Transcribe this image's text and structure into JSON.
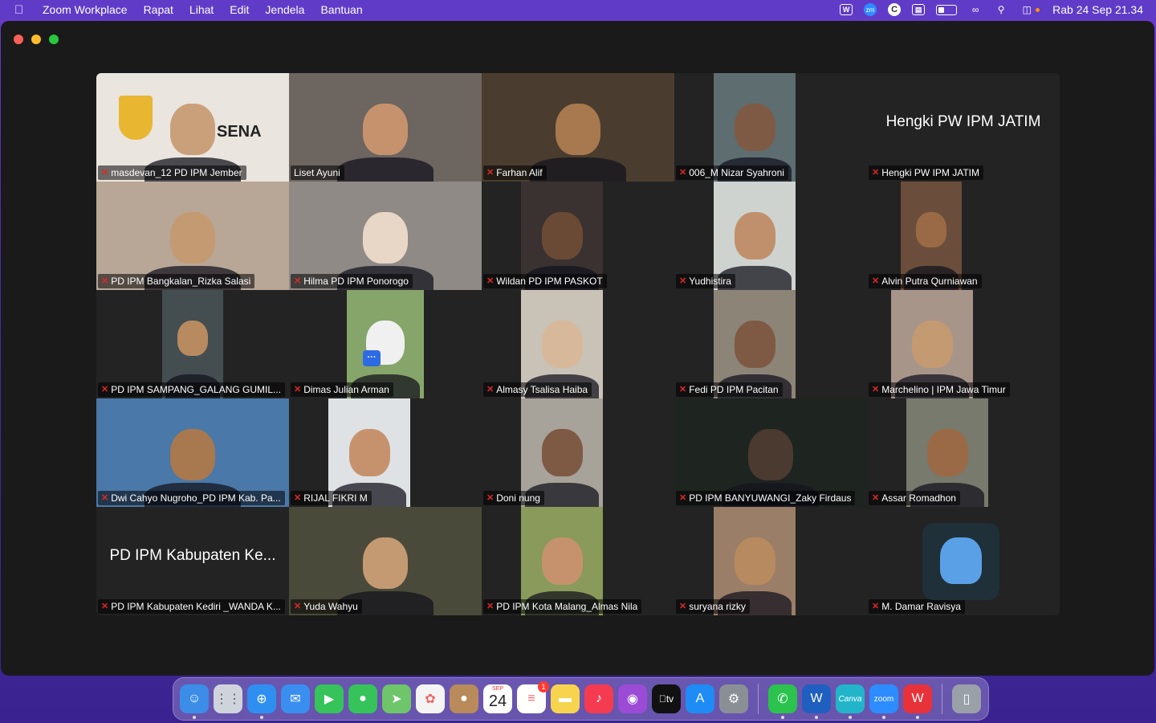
{
  "menubar": {
    "app_name": "Zoom Workplace",
    "menus": [
      "Rapat",
      "Lihat",
      "Edit",
      "Jendela",
      "Bantuan"
    ],
    "clock": "Rab 24 Sep  21.34",
    "status_icons": [
      "word-icon",
      "zoom-icon",
      "c-icon",
      "screen-mirror-icon",
      "battery-icon",
      "link-icon",
      "search-icon",
      "control-center-icon"
    ]
  },
  "meeting": {
    "participants": [
      {
        "name": "masdevan_12 PD IPM Jember",
        "muted": true,
        "video": true,
        "active": false
      },
      {
        "name": "Liset Ayuni",
        "muted": false,
        "video": true,
        "active": true
      },
      {
        "name": "Farhan Alif",
        "muted": true,
        "video": true,
        "active": false
      },
      {
        "name": "006_M Nizar Syahroni",
        "muted": true,
        "video": true,
        "active": false
      },
      {
        "name": "Hengki PW IPM JATIM",
        "display": "Hengki PW IPM JATIM",
        "muted": true,
        "video": false,
        "active": false
      },
      {
        "name": "PD IPM Bangkalan_Rizka Salasi",
        "muted": true,
        "video": true,
        "active": false
      },
      {
        "name": "Hilma PD IPM Ponorogo",
        "muted": true,
        "video": true,
        "active": false
      },
      {
        "name": "Wildan PD IPM PASKOT",
        "muted": true,
        "video": true,
        "active": false
      },
      {
        "name": "Yudhistira",
        "muted": true,
        "video": true,
        "active": false
      },
      {
        "name": "Alvin Putra Qurniawan",
        "muted": true,
        "video": true,
        "active": false
      },
      {
        "name": "PD IPM SAMPANG_GALANG GUMIL...",
        "muted": true,
        "video": true,
        "active": false
      },
      {
        "name": "Dimas Julian Arman",
        "muted": true,
        "video": true,
        "active": false
      },
      {
        "name": "Almasy Tsalisa Haiba",
        "muted": true,
        "video": true,
        "active": false
      },
      {
        "name": "Fedi PD IPM Pacitan",
        "muted": true,
        "video": true,
        "active": false
      },
      {
        "name": "Marchelino | IPM Jawa Timur",
        "muted": true,
        "video": true,
        "active": false
      },
      {
        "name": "Dwi Cahyo Nugroho_PD IPM Kab. Pa...",
        "muted": true,
        "video": true,
        "active": false
      },
      {
        "name": "RIJAL FIKRI M",
        "muted": true,
        "video": true,
        "active": false
      },
      {
        "name": "Doni nung",
        "muted": true,
        "video": true,
        "active": false
      },
      {
        "name": "PD IPM BANYUWANGI_Zaky Firdaus",
        "muted": true,
        "video": true,
        "active": false
      },
      {
        "name": "Assar Romadhon",
        "muted": true,
        "video": true,
        "active": false
      },
      {
        "name": "PD IPM Kabupaten Kediri _WANDA K...",
        "display": "PD IPM Kabupaten Ke...",
        "muted": true,
        "video": false,
        "active": false
      },
      {
        "name": "Yuda Wahyu",
        "muted": true,
        "video": true,
        "active": false
      },
      {
        "name": "PD IPM Kota Malang_Almas Nila",
        "muted": true,
        "video": true,
        "active": false
      },
      {
        "name": "suryana rizky",
        "muted": true,
        "video": true,
        "active": false
      },
      {
        "name": "M. Damar Ravisya",
        "muted": true,
        "video": false,
        "active": false
      }
    ],
    "more_button": "···",
    "tile1_logo_text": "SENA"
  },
  "dock": {
    "apps": [
      "Finder",
      "Launchpad",
      "Safari",
      "Mail",
      "FaceTime",
      "Messages",
      "Maps",
      "Photos",
      "Contacts",
      "Calendar",
      "Reminders",
      "Notes",
      "Music",
      "Podcasts",
      "TV",
      "App Store",
      "System Settings",
      "WhatsApp",
      "Word",
      "Canva",
      "Zoom",
      "WPS Office",
      "Trash"
    ],
    "calendar_month": "SEP",
    "calendar_day": "24",
    "tv_label": "tv",
    "canva_label": "Canva",
    "zoom_label": "zoom",
    "reminders_badge": "1"
  },
  "colors": {
    "active_speaker_border": "#3ec93e",
    "muted_icon": "#e02828",
    "window_bg": "#1a1a1a",
    "tile_bg": "#232323"
  }
}
